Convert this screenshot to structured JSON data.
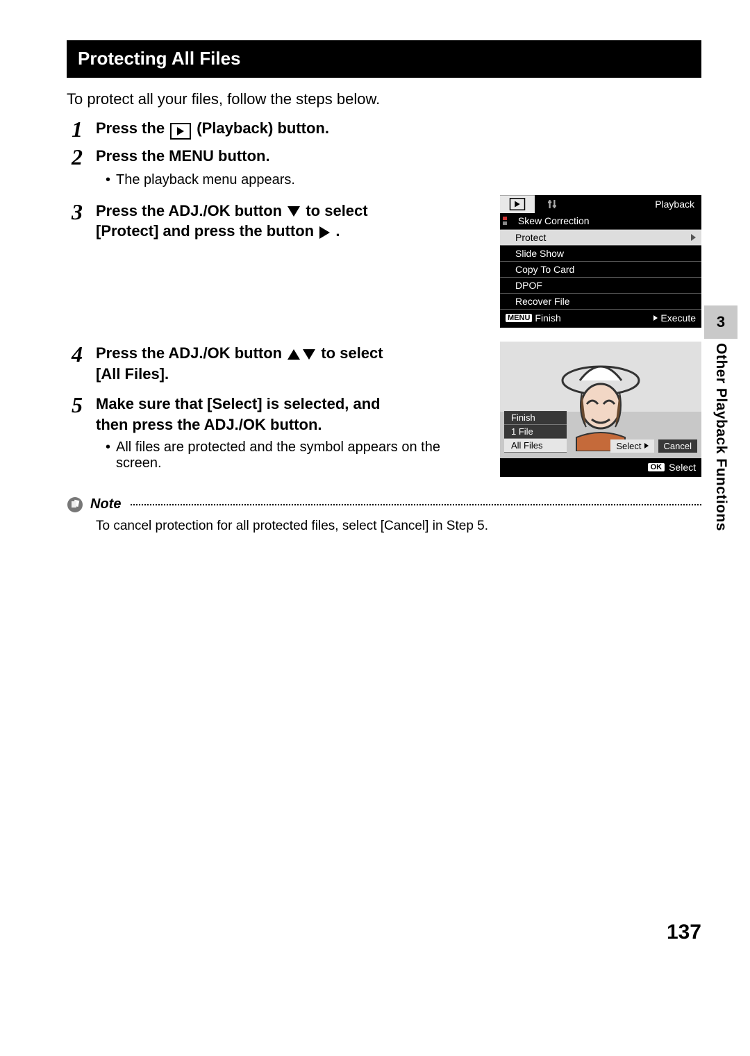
{
  "header": {
    "title": "Protecting All Files"
  },
  "intro": "To protect all your files, follow the steps below.",
  "steps": {
    "s1": {
      "num": "1",
      "pre": "Press the ",
      "post": " (Playback) button."
    },
    "s2": {
      "num": "2",
      "title": "Press the MENU button.",
      "bullet": "The playback menu appears."
    },
    "s3": {
      "num": "3",
      "title_a": "Press the ADJ./OK button ",
      "title_b": " to select [Protect] and press the button ",
      "title_c": "."
    },
    "s4": {
      "num": "4",
      "title_a": "Press the ADJ./OK button ",
      "title_b": " to select [All Files]."
    },
    "s5": {
      "num": "5",
      "title": "Make sure that [Select] is selected, and then press the ADJ./OK button.",
      "bullet": "All files are protected and the symbol appears on the screen."
    }
  },
  "lcd1": {
    "tab_label": "Playback",
    "items": [
      "Skew Correction",
      "Protect",
      "Slide Show",
      "Copy To Card",
      "DPOF",
      "Recover File"
    ],
    "selected": "Protect",
    "footer_left_chip": "MENU",
    "footer_left": "Finish",
    "footer_right": "Execute"
  },
  "lcd2": {
    "options": [
      "Finish",
      "1 File",
      "All Files"
    ],
    "selected_option": "All Files",
    "actions": [
      "Select",
      "Cancel"
    ],
    "selected_action": "Select",
    "footer_chip": "OK",
    "footer_label": "Select"
  },
  "note": {
    "label": "Note",
    "text": "To cancel protection for all protected files, select [Cancel] in Step 5."
  },
  "side": {
    "chapter": "3",
    "label": "Other Playback Functions"
  },
  "page_number": "137"
}
